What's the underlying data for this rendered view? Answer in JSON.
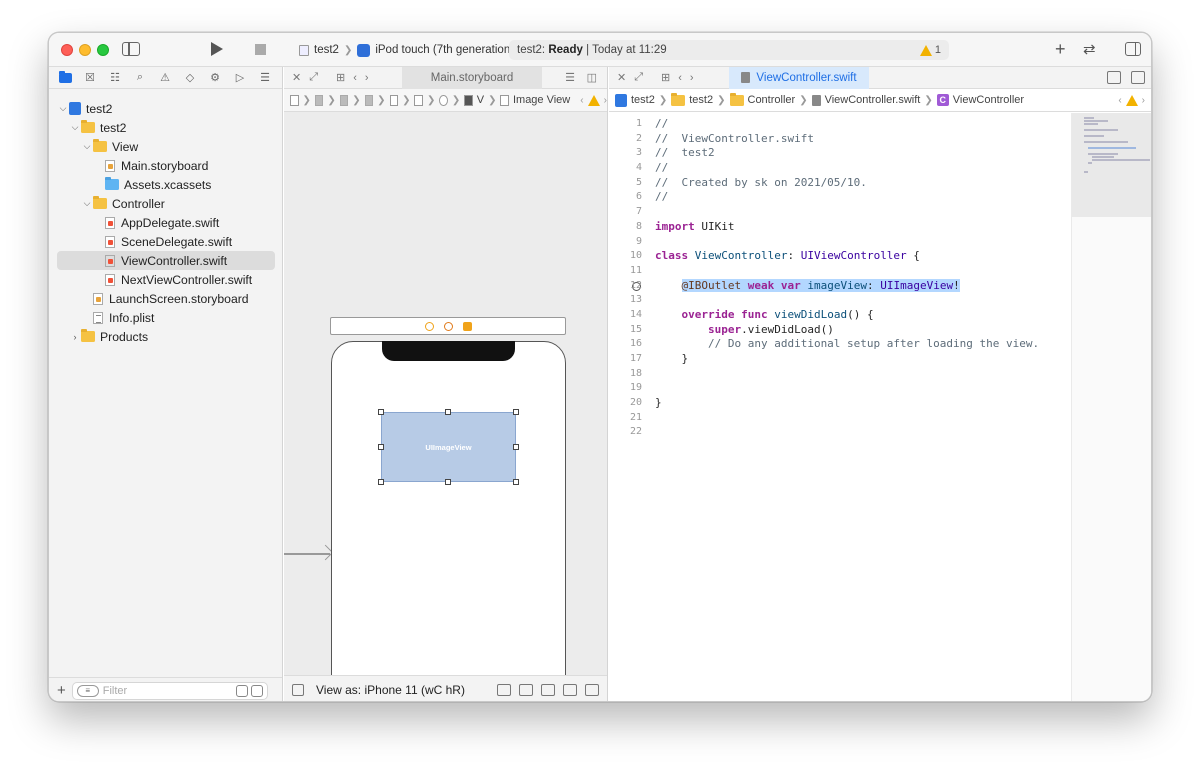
{
  "toolbar": {
    "scheme": "test2",
    "device": "iPod touch (7th generation)",
    "status_project": "test2:",
    "status_state": "Ready",
    "status_time": "Today at 11:29",
    "warning_count": "1"
  },
  "navigator": {
    "filter_placeholder": "Filter",
    "items": [
      {
        "label": "test2"
      },
      {
        "label": "test2"
      },
      {
        "label": "View"
      },
      {
        "label": "Main.storyboard"
      },
      {
        "label": "Assets.xcassets"
      },
      {
        "label": "Controller"
      },
      {
        "label": "AppDelegate.swift"
      },
      {
        "label": "SceneDelegate.swift"
      },
      {
        "label": "ViewController.swift"
      },
      {
        "label": "NextViewController.swift"
      },
      {
        "label": "LaunchScreen.storyboard"
      },
      {
        "label": "Info.plist"
      },
      {
        "label": "Products"
      }
    ]
  },
  "ib_editor": {
    "tab_label": "Main.storyboard",
    "jump_v": "V",
    "jump_last": "Image View",
    "imageview_label": "UIImageView",
    "view_as": "View as: iPhone 11 (",
    "view_as_traits": "wC hR)"
  },
  "code_editor": {
    "tab_label": "ViewController.swift",
    "jump": [
      "test2",
      "test2",
      "Controller",
      "ViewController.swift",
      "ViewController"
    ],
    "class_badge": "C",
    "lines": [
      "//",
      "//  ViewController.swift",
      "//  test2",
      "//",
      "//  Created by sk on 2021/05/10.",
      "//",
      "",
      "import UIKit",
      "",
      "class ViewController: UIViewController {",
      "",
      "    @IBOutlet weak var imageView: UIImageView!",
      "",
      "    override func viewDidLoad() {",
      "        super.viewDidLoad()",
      "        // Do any additional setup after loading the view.",
      "    }",
      "",
      "",
      "}",
      "",
      ""
    ],
    "line_numbers": [
      "1",
      "2",
      "3",
      "4",
      "5",
      "6",
      "7",
      "8",
      "9",
      "10",
      "11",
      "12",
      "13",
      "14",
      "15",
      "16",
      "17",
      "18",
      "19",
      "20",
      "21",
      "22"
    ]
  }
}
